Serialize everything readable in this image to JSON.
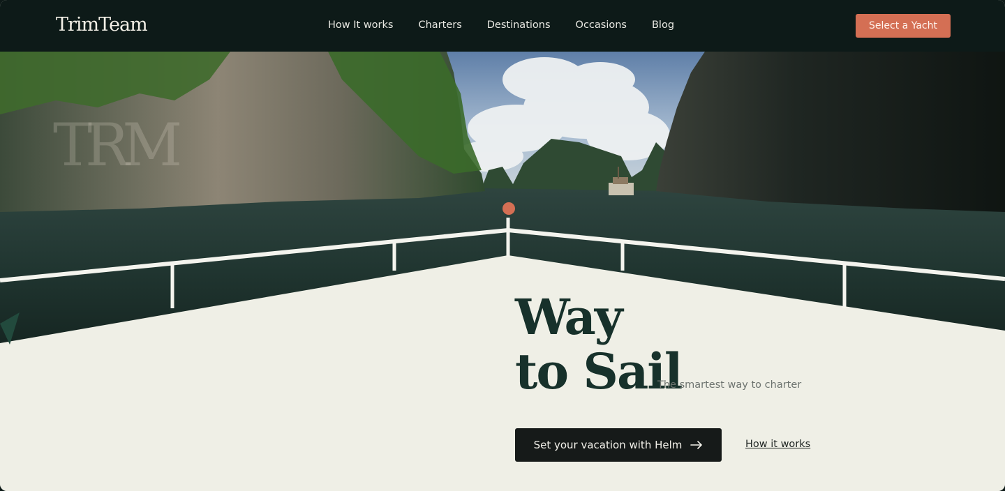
{
  "brand": {
    "logo_text": "TrimTeam",
    "watermark_text": "TRM"
  },
  "nav": {
    "items": [
      {
        "label": "How It works"
      },
      {
        "label": "Charters"
      },
      {
        "label": "Destinations"
      },
      {
        "label": "Occasions"
      },
      {
        "label": "Blog"
      }
    ]
  },
  "header": {
    "cta_label": "Select a Yacht"
  },
  "hero": {
    "title_line1": "Way",
    "title_line2": "to Sail",
    "subtitle": "The smartest way to charter",
    "primary_button_label": "Set your vacation with Helm",
    "secondary_link_label": "How it works"
  },
  "colors": {
    "header_bg": "#0d1a18",
    "accent": "#d46f54",
    "deck": "#efefe6",
    "title": "#17312b",
    "button_dark": "#161a19"
  },
  "icons": {
    "button_icon": "arrow-right-icon"
  }
}
